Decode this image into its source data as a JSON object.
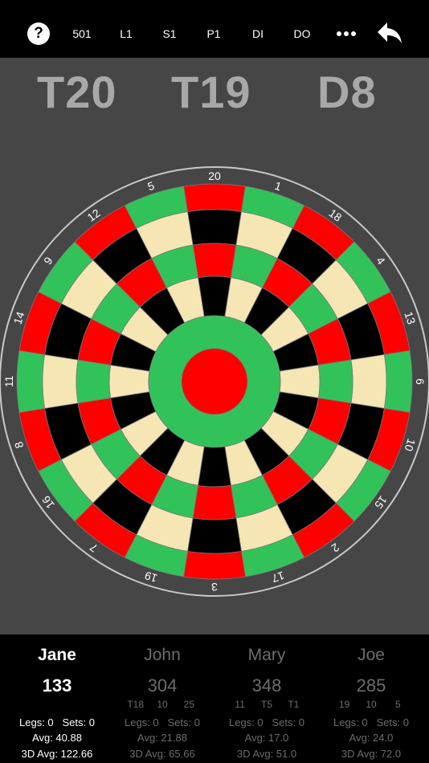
{
  "toolbar": {
    "help_label": "?",
    "game_label": "501",
    "legs_label": "L1",
    "sets_label": "S1",
    "player_label": "P1",
    "double_in_label": "DI",
    "double_out_label": "DO",
    "more_icon": "more-dots-icon",
    "undo_icon": "undo-arrow-icon"
  },
  "checkout": [
    "T20",
    "T19",
    "D8"
  ],
  "board": {
    "numbers": [
      20,
      1,
      18,
      4,
      13,
      6,
      10,
      15,
      2,
      17,
      3,
      19,
      7,
      16,
      8,
      11,
      14,
      9,
      12,
      5
    ],
    "colors": {
      "red": "#ff0000",
      "green": "#31c35a",
      "black": "#000000",
      "cream": "#f5e6b4",
      "background": "#464646",
      "ring": "#c8c8c8"
    }
  },
  "players": [
    {
      "name": "Jane",
      "score": "133",
      "last_darts": [],
      "legs": "Legs: 0",
      "sets": "Sets: 0",
      "avg": "Avg: 40.88",
      "avg3d": "3D Avg: 122.66",
      "active": true
    },
    {
      "name": "John",
      "score": "304",
      "last_darts": [
        "T18",
        "10",
        "25"
      ],
      "legs": "Legs: 0",
      "sets": "Sets: 0",
      "avg": "Avg: 21.88",
      "avg3d": "3D Avg: 65.66",
      "active": false
    },
    {
      "name": "Mary",
      "score": "348",
      "last_darts": [
        "11",
        "T5",
        "T1"
      ],
      "legs": "Legs: 0",
      "sets": "Sets: 0",
      "avg": "Avg: 17.0",
      "avg3d": "3D Avg: 51.0",
      "active": false
    },
    {
      "name": "Joe",
      "score": "285",
      "last_darts": [
        "19",
        "10",
        "5"
      ],
      "legs": "Legs: 0",
      "sets": "Sets: 0",
      "avg": "Avg: 24.0",
      "avg3d": "3D Avg: 72.0",
      "active": false
    }
  ]
}
